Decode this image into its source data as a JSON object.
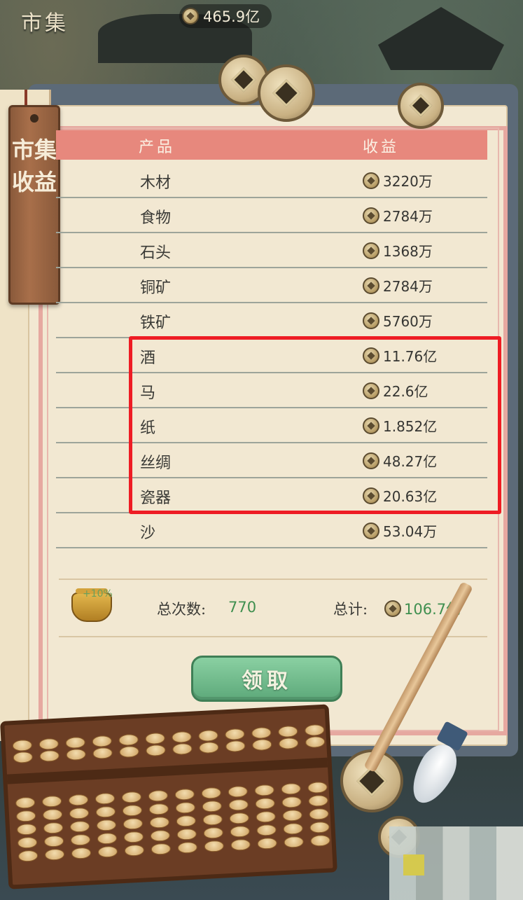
{
  "top_bar": {
    "title": "市集",
    "currency": "465.9亿"
  },
  "panel": {
    "tag_title": "市集收益",
    "columns": {
      "product": "产品",
      "income": "收益"
    },
    "rows": [
      {
        "name": "木材",
        "value": "3220万"
      },
      {
        "name": "食物",
        "value": "2784万"
      },
      {
        "name": "石头",
        "value": "1368万"
      },
      {
        "name": "铜矿",
        "value": "2784万"
      },
      {
        "name": "铁矿",
        "value": "5760万"
      },
      {
        "name": "酒",
        "value": "11.76亿"
      },
      {
        "name": "马",
        "value": "22.6亿"
      },
      {
        "name": "纸",
        "value": "1.852亿"
      },
      {
        "name": "丝绸",
        "value": "48.27亿"
      },
      {
        "name": "瓷器",
        "value": "20.63亿"
      },
      {
        "name": "沙",
        "value": "53.04万"
      }
    ],
    "bonus": "+10%",
    "total_count_label": "总次数:",
    "total_count": "770",
    "total_label": "总计:",
    "total_value": "106.7亿",
    "claim_button": "领取"
  },
  "colors": {
    "header": "#e7887d",
    "highlight": "#ee1c24",
    "button": "#6dbb88",
    "value_green": "#3f8f4f"
  }
}
